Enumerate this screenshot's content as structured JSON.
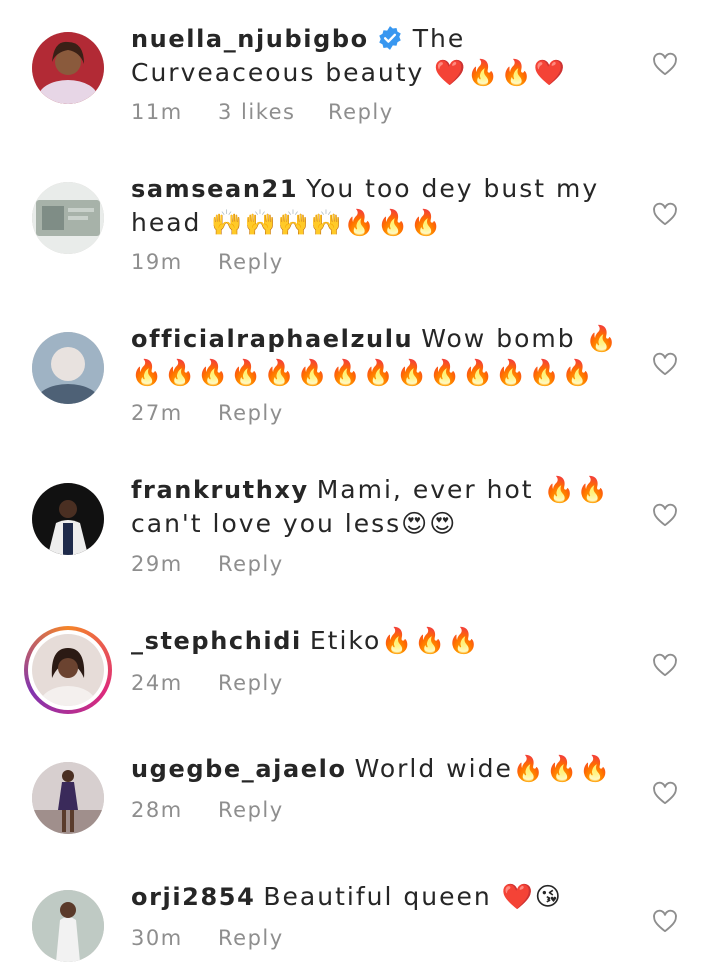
{
  "comments": [
    {
      "username": "nuella_njubigbo",
      "verified": true,
      "text": "The Curveaceous beauty ❤️🔥🔥❤️",
      "time": "11m",
      "likes": "3 likes",
      "reply": "Reply",
      "avatar_color": "#b22a35"
    },
    {
      "username": "samsean21",
      "text": "You too dey bust my head 🙌🙌🙌🙌🔥🔥🔥",
      "time": "19m",
      "reply": "Reply",
      "avatar_color": "#a7b2a9"
    },
    {
      "username": "officialraphaelzulu",
      "text": "Wow bomb 🔥🔥🔥🔥🔥🔥🔥🔥🔥🔥🔥🔥🔥🔥🔥",
      "time": "27m",
      "reply": "Reply",
      "avatar_color": "#7f94a8"
    },
    {
      "username": "frankruthxy",
      "text": "Mami, ever hot 🔥🔥 can't love you less😍😍",
      "time": "29m",
      "reply": "Reply",
      "avatar_color": "#1c1c1c"
    },
    {
      "username": "_stephchidi",
      "story_ring": true,
      "text": "Etiko🔥🔥🔥",
      "time": "24m",
      "reply": "Reply",
      "avatar_color": "#d9c8c3"
    },
    {
      "username": "ugegbe_ajaelo",
      "text": "World wide🔥🔥🔥",
      "time": "28m",
      "reply": "Reply",
      "avatar_color": "#c7b6b4"
    },
    {
      "username": "orji2854",
      "text": "Beautiful queen ❤️😘",
      "time": "30m",
      "reply": "Reply",
      "avatar_color": "#8fa19a"
    }
  ],
  "colors": {
    "text": "#262626",
    "meta": "#8e8e8e",
    "verified": "#3897f0"
  }
}
